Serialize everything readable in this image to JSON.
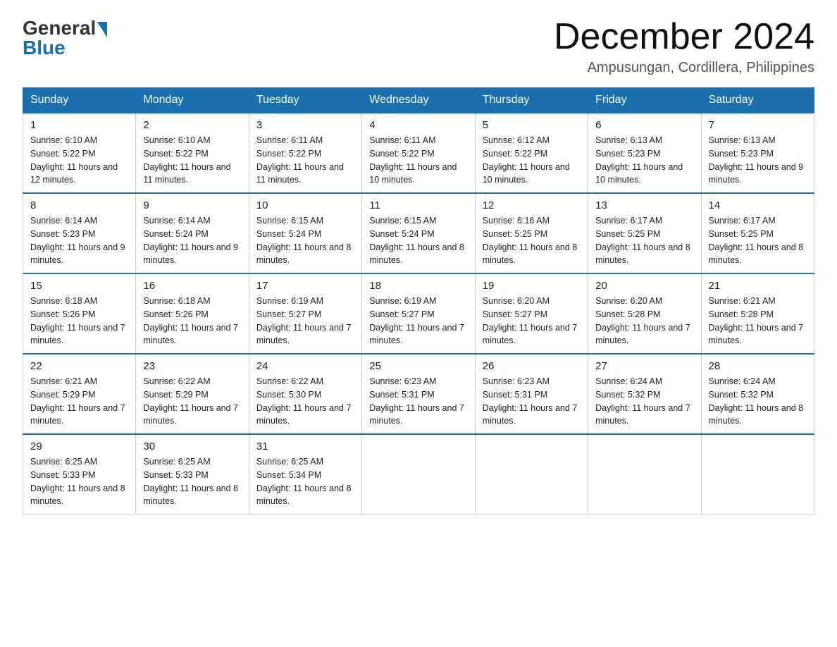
{
  "logo": {
    "general": "General",
    "blue": "Blue"
  },
  "title": "December 2024",
  "location": "Ampusungan, Cordillera, Philippines",
  "days_of_week": [
    "Sunday",
    "Monday",
    "Tuesday",
    "Wednesday",
    "Thursday",
    "Friday",
    "Saturday"
  ],
  "weeks": [
    [
      {
        "day": "1",
        "sunrise": "6:10 AM",
        "sunset": "5:22 PM",
        "daylight": "11 hours and 12 minutes."
      },
      {
        "day": "2",
        "sunrise": "6:10 AM",
        "sunset": "5:22 PM",
        "daylight": "11 hours and 11 minutes."
      },
      {
        "day": "3",
        "sunrise": "6:11 AM",
        "sunset": "5:22 PM",
        "daylight": "11 hours and 11 minutes."
      },
      {
        "day": "4",
        "sunrise": "6:11 AM",
        "sunset": "5:22 PM",
        "daylight": "11 hours and 10 minutes."
      },
      {
        "day": "5",
        "sunrise": "6:12 AM",
        "sunset": "5:22 PM",
        "daylight": "11 hours and 10 minutes."
      },
      {
        "day": "6",
        "sunrise": "6:13 AM",
        "sunset": "5:23 PM",
        "daylight": "11 hours and 10 minutes."
      },
      {
        "day": "7",
        "sunrise": "6:13 AM",
        "sunset": "5:23 PM",
        "daylight": "11 hours and 9 minutes."
      }
    ],
    [
      {
        "day": "8",
        "sunrise": "6:14 AM",
        "sunset": "5:23 PM",
        "daylight": "11 hours and 9 minutes."
      },
      {
        "day": "9",
        "sunrise": "6:14 AM",
        "sunset": "5:24 PM",
        "daylight": "11 hours and 9 minutes."
      },
      {
        "day": "10",
        "sunrise": "6:15 AM",
        "sunset": "5:24 PM",
        "daylight": "11 hours and 8 minutes."
      },
      {
        "day": "11",
        "sunrise": "6:15 AM",
        "sunset": "5:24 PM",
        "daylight": "11 hours and 8 minutes."
      },
      {
        "day": "12",
        "sunrise": "6:16 AM",
        "sunset": "5:25 PM",
        "daylight": "11 hours and 8 minutes."
      },
      {
        "day": "13",
        "sunrise": "6:17 AM",
        "sunset": "5:25 PM",
        "daylight": "11 hours and 8 minutes."
      },
      {
        "day": "14",
        "sunrise": "6:17 AM",
        "sunset": "5:25 PM",
        "daylight": "11 hours and 8 minutes."
      }
    ],
    [
      {
        "day": "15",
        "sunrise": "6:18 AM",
        "sunset": "5:26 PM",
        "daylight": "11 hours and 7 minutes."
      },
      {
        "day": "16",
        "sunrise": "6:18 AM",
        "sunset": "5:26 PM",
        "daylight": "11 hours and 7 minutes."
      },
      {
        "day": "17",
        "sunrise": "6:19 AM",
        "sunset": "5:27 PM",
        "daylight": "11 hours and 7 minutes."
      },
      {
        "day": "18",
        "sunrise": "6:19 AM",
        "sunset": "5:27 PM",
        "daylight": "11 hours and 7 minutes."
      },
      {
        "day": "19",
        "sunrise": "6:20 AM",
        "sunset": "5:27 PM",
        "daylight": "11 hours and 7 minutes."
      },
      {
        "day": "20",
        "sunrise": "6:20 AM",
        "sunset": "5:28 PM",
        "daylight": "11 hours and 7 minutes."
      },
      {
        "day": "21",
        "sunrise": "6:21 AM",
        "sunset": "5:28 PM",
        "daylight": "11 hours and 7 minutes."
      }
    ],
    [
      {
        "day": "22",
        "sunrise": "6:21 AM",
        "sunset": "5:29 PM",
        "daylight": "11 hours and 7 minutes."
      },
      {
        "day": "23",
        "sunrise": "6:22 AM",
        "sunset": "5:29 PM",
        "daylight": "11 hours and 7 minutes."
      },
      {
        "day": "24",
        "sunrise": "6:22 AM",
        "sunset": "5:30 PM",
        "daylight": "11 hours and 7 minutes."
      },
      {
        "day": "25",
        "sunrise": "6:23 AM",
        "sunset": "5:31 PM",
        "daylight": "11 hours and 7 minutes."
      },
      {
        "day": "26",
        "sunrise": "6:23 AM",
        "sunset": "5:31 PM",
        "daylight": "11 hours and 7 minutes."
      },
      {
        "day": "27",
        "sunrise": "6:24 AM",
        "sunset": "5:32 PM",
        "daylight": "11 hours and 7 minutes."
      },
      {
        "day": "28",
        "sunrise": "6:24 AM",
        "sunset": "5:32 PM",
        "daylight": "11 hours and 8 minutes."
      }
    ],
    [
      {
        "day": "29",
        "sunrise": "6:25 AM",
        "sunset": "5:33 PM",
        "daylight": "11 hours and 8 minutes."
      },
      {
        "day": "30",
        "sunrise": "6:25 AM",
        "sunset": "5:33 PM",
        "daylight": "11 hours and 8 minutes."
      },
      {
        "day": "31",
        "sunrise": "6:25 AM",
        "sunset": "5:34 PM",
        "daylight": "11 hours and 8 minutes."
      },
      null,
      null,
      null,
      null
    ]
  ]
}
